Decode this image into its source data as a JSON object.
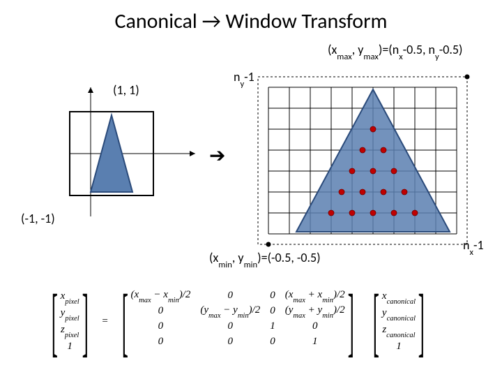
{
  "title_pre": "Canonical ",
  "title_arrow": "→",
  "title_post": " Window Transform",
  "left": {
    "label_tl": "(1, 1)",
    "label_bl": "(-1, -1)"
  },
  "right": {
    "label_tr_pre": "(x",
    "label_tr_s1": "max",
    "label_tr_mid1": ", y",
    "label_tr_s2": "max",
    "label_tr_mid2": ")=(n",
    "label_tr_s3": "x",
    "label_tr_mid3": "-0.5, n",
    "label_tr_s4": "y",
    "label_tr_end": "-0.5)",
    "label_bl_pre": "(x",
    "label_bl_s1": "min",
    "label_bl_mid": ", y",
    "label_bl_s2": "min",
    "label_bl_end": ")=(-0.5, -0.5)",
    "label_xaxis_pre": "n",
    "label_xaxis_s": "x",
    "label_xaxis_end": "-1",
    "label_yaxis_pre": "n",
    "label_yaxis_s": "y",
    "label_yaxis_end": "-1"
  },
  "matrix": {
    "lhs": [
      "x",
      "y",
      "z",
      "1"
    ],
    "lhs_sub": [
      "pixel",
      "pixel",
      "pixel",
      ""
    ],
    "m": [
      [
        "(x_max − x_min)/2",
        "0",
        "0",
        "(x_max + x_min)/2"
      ],
      [
        "0",
        "(y_max − y_min)/2",
        "0",
        "(y_max + y_min)/2"
      ],
      [
        "0",
        "0",
        "1",
        "0"
      ],
      [
        "0",
        "0",
        "0",
        "1"
      ]
    ],
    "rhs": [
      "x",
      "y",
      "z",
      "1"
    ],
    "rhs_sub": [
      "canonical",
      "canonical",
      "canonical",
      ""
    ]
  }
}
